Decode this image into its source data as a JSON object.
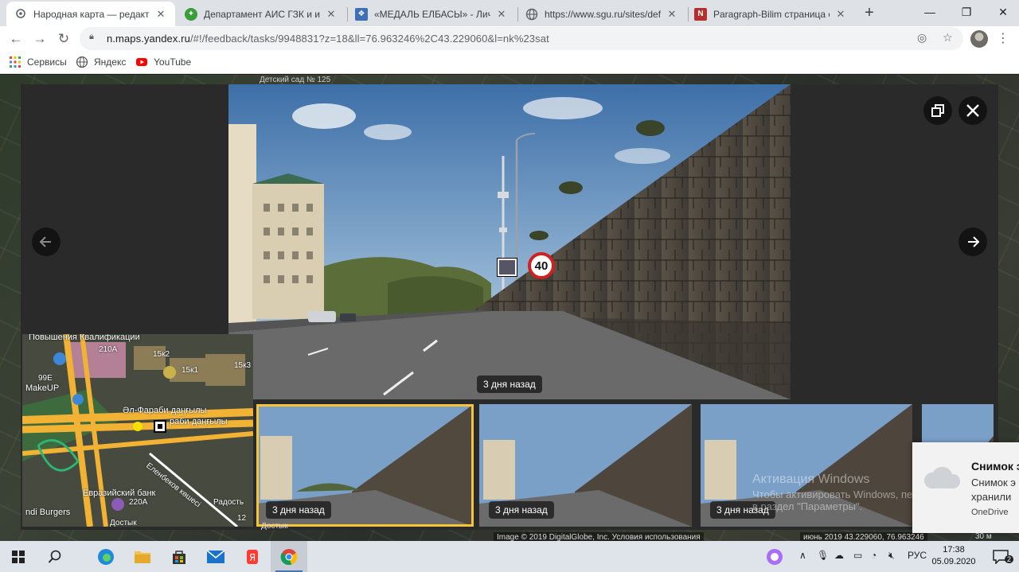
{
  "browser": {
    "tabs": [
      {
        "title": "Народная карта — редактор",
        "favicon": "pin-icon",
        "active": true
      },
      {
        "title": "Департамент АИС ГЗК и инф",
        "favicon": "globe-green-icon",
        "active": false
      },
      {
        "title": "«МЕДАЛЬ ЕЛБАСЫ» - Личный",
        "favicon": "document-icon",
        "active": false
      },
      {
        "title": "https://www.sgu.ru/sites/defau",
        "favicon": "globe-icon",
        "active": false
      },
      {
        "title": "Paragraph-Bilim страница студ",
        "favicon": "paragraph-logo-icon",
        "active": false
      }
    ],
    "url_host": "n.maps.yandex.ru",
    "url_path": "/#!/feedback/tasks/9948831?z=18&ll=76.963246%2C43.229060&l=nk%23sat",
    "bookmarks": [
      {
        "label": "Сервисы",
        "icon": "apps-grid-icon"
      },
      {
        "label": "Яндекс",
        "icon": "yandex-icon"
      },
      {
        "label": "YouTube",
        "icon": "youtube-icon"
      }
    ]
  },
  "viewer": {
    "photo_date": "3 дня назад",
    "speed_sign": "40",
    "thumbnails": [
      {
        "date": "3 дня назад",
        "selected": true
      },
      {
        "date": "3 дня назад",
        "selected": false
      },
      {
        "date": "3 дня назад",
        "selected": false
      }
    ]
  },
  "minimap": {
    "labels": {
      "institute": "Повышения Квалификации",
      "b210a": "210А",
      "b15k2": "15к2",
      "b15k1": "15к1",
      "b15k3": "15к3",
      "b99e": "99Е",
      "makeup": "MakeUP",
      "street1": "Әл-Фараби даңғылы",
      "street2": "раби даңғылы",
      "street3": "Еленбеков көшесі",
      "bank": "Евразийский банк",
      "b220a": "220А",
      "burgers": "ndi Burgers",
      "radost": "Радость",
      "b12": "12",
      "dostyk": "Достык"
    }
  },
  "map_background": {
    "detsad": "Детский сад № 125",
    "dostyk2": "Достык"
  },
  "overlay": {
    "activate_title": "Активация Windows",
    "activate_body1": "Чтобы активировать Windows, перейдите",
    "activate_body2": "в раздел \"Параметры\".",
    "attribution": "Image © 2019 DigitalGlobe, Inc. Условия использования",
    "coords": "июнь 2019   43.229060, 76.963246",
    "scale": "30 м"
  },
  "notification": {
    "title": "Снимок э",
    "body1": "Снимок э",
    "body2": "хранили",
    "source": "OneDrive"
  },
  "taskbar": {
    "lang": "РУС",
    "time": "17:38",
    "date": "05.09.2020",
    "notif_count": "2"
  },
  "colors": {
    "accent_selected": "#f6c33b",
    "chrome_tabstrip": "#dee1e6"
  }
}
